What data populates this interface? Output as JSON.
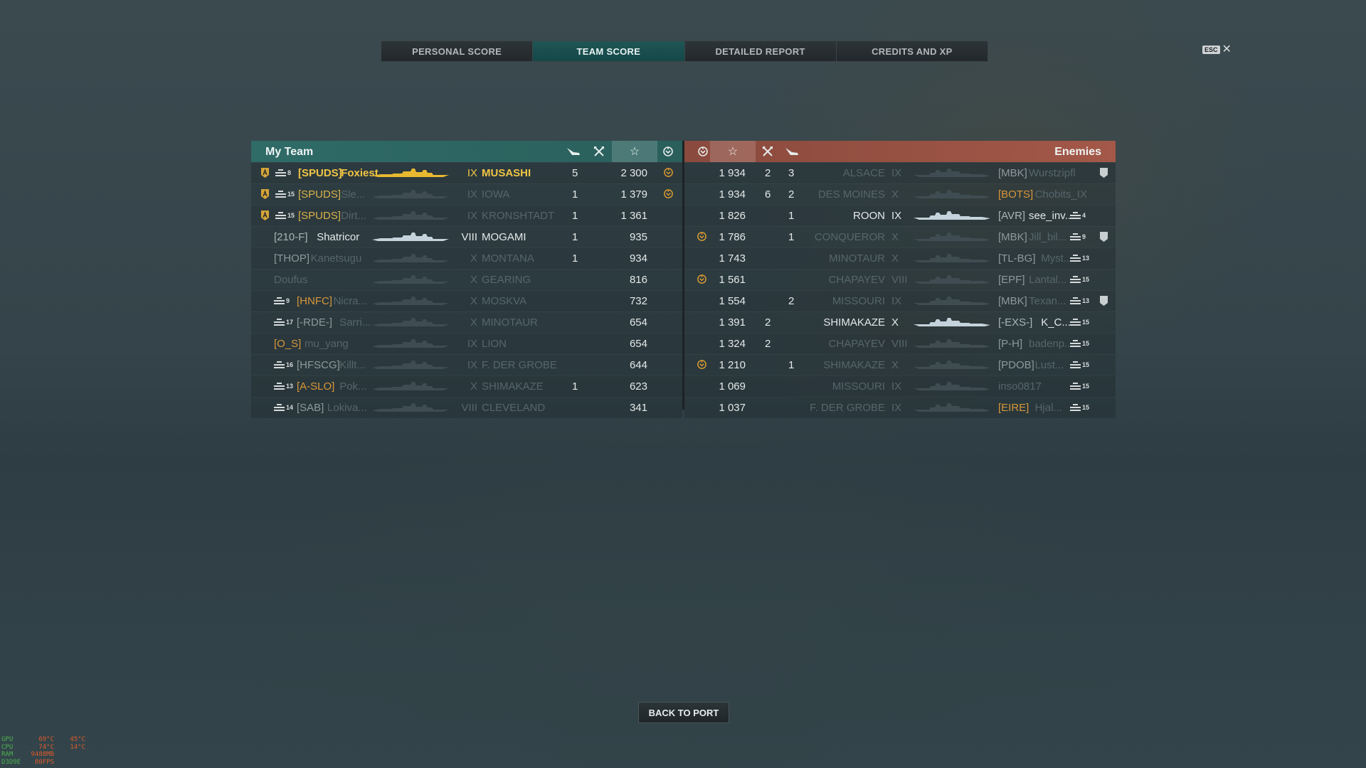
{
  "tabs": [
    "PERSONAL SCORE",
    "TEAM SCORE",
    "DETAILED REPORT",
    "CREDITS AND XP"
  ],
  "active_tab": 1,
  "close": {
    "key": "ESC",
    "symbol": "✕"
  },
  "my_team": {
    "title": "My Team",
    "rows": [
      {
        "division": true,
        "rank": "8",
        "clan": "[SPUDS]",
        "name": "Foxiest",
        "tier": "IX",
        "ship": "MUSASHI",
        "kills": "5",
        "xp": "2 300",
        "ribbon": true,
        "style": "self"
      },
      {
        "division": true,
        "rank": "15",
        "clan": "[SPUDS]",
        "name": "Sle...",
        "tier": "IX",
        "ship": "IOWA",
        "kills": "1",
        "xp": "1 379",
        "ribbon": true,
        "style": "div"
      },
      {
        "division": true,
        "rank": "15",
        "clan": "[SPUDS]",
        "name": "Dirt...",
        "tier": "IX",
        "ship": "KRONSHTADT",
        "kills": "1",
        "xp": "1 361",
        "ribbon": false,
        "style": "div"
      },
      {
        "division": false,
        "rank": "",
        "clan": "[210-F]",
        "name": "Shatricor",
        "tier": "VIII",
        "ship": "MOGAMI",
        "kills": "1",
        "xp": "935",
        "ribbon": false,
        "style": "alive"
      },
      {
        "division": false,
        "rank": "",
        "clan": "[THOP]",
        "name": "Kanetsugu",
        "tier": "X",
        "ship": "MONTANA",
        "kills": "1",
        "xp": "934",
        "ribbon": false,
        "style": "dead"
      },
      {
        "division": false,
        "rank": "",
        "clan": "",
        "name": "Doufus",
        "tier": "X",
        "ship": "GEARING",
        "kills": "",
        "xp": "816",
        "ribbon": false,
        "style": "dead"
      },
      {
        "division": false,
        "rank": "9",
        "clan": "[HNFC]",
        "name": "Nicra...",
        "tier": "X",
        "ship": "MOSKVA",
        "kills": "",
        "xp": "732",
        "ribbon": false,
        "style": "dead-orange"
      },
      {
        "division": false,
        "rank": "17",
        "clan": "[-RDE-]",
        "name": "Sarri...",
        "tier": "X",
        "ship": "MINOTAUR",
        "kills": "",
        "xp": "654",
        "ribbon": false,
        "style": "dead"
      },
      {
        "division": false,
        "rank": "",
        "clan": "[O_S]",
        "name": "mu_yang",
        "tier": "IX",
        "ship": "LION",
        "kills": "",
        "xp": "654",
        "ribbon": false,
        "style": "dead-orange"
      },
      {
        "division": false,
        "rank": "16",
        "clan": "[HFSCG]",
        "name": "Killt...",
        "tier": "IX",
        "ship": "F. DER GROBE",
        "kills": "",
        "xp": "644",
        "ribbon": false,
        "style": "dead"
      },
      {
        "division": false,
        "rank": "13",
        "clan": "[A-SLO]",
        "name": "Pok...",
        "tier": "X",
        "ship": "SHIMAKAZE",
        "kills": "1",
        "xp": "623",
        "ribbon": false,
        "style": "dead-orange"
      },
      {
        "division": false,
        "rank": "14",
        "clan": "[SAB]",
        "name": "Lokiva...",
        "tier": "VIII",
        "ship": "CLEVELAND",
        "kills": "",
        "xp": "341",
        "ribbon": false,
        "style": "dead"
      }
    ]
  },
  "enemies": {
    "title": "Enemies",
    "rows": [
      {
        "ribbon": false,
        "xp": "1 934",
        "kills": "2",
        "planes": "3",
        "ship": "ALSACE",
        "tier": "IX",
        "clan": "[MBK]",
        "name": "Wurstzipfl",
        "rank": "",
        "badge": true,
        "style": "dead"
      },
      {
        "ribbon": false,
        "xp": "1 934",
        "kills": "6",
        "planes": "2",
        "ship": "DES MOINES",
        "tier": "X",
        "clan": "[BOTS]",
        "name": "Chobits_IX",
        "rank": "",
        "badge": false,
        "style": "dead-orange"
      },
      {
        "ribbon": false,
        "xp": "1 826",
        "kills": "",
        "planes": "1",
        "ship": "ROON",
        "tier": "IX",
        "clan": "[AVR]",
        "name": "see_inv...",
        "rank": "4",
        "badge": false,
        "style": "alive"
      },
      {
        "ribbon": true,
        "xp": "1 786",
        "kills": "",
        "planes": "1",
        "ship": "CONQUEROR",
        "tier": "X",
        "clan": "[MBK]",
        "name": "Jill_bil...",
        "rank": "9",
        "badge": true,
        "style": "dead"
      },
      {
        "ribbon": false,
        "xp": "1 743",
        "kills": "",
        "planes": "",
        "ship": "MINOTAUR",
        "tier": "X",
        "clan": "[TL-BG]",
        "name": "Myst...",
        "rank": "13",
        "badge": false,
        "style": "dead"
      },
      {
        "ribbon": true,
        "xp": "1 561",
        "kills": "",
        "planes": "",
        "ship": "CHAPAYEV",
        "tier": "VIII",
        "clan": "[EPF]",
        "name": "Lantal...",
        "rank": "15",
        "badge": false,
        "style": "dead"
      },
      {
        "ribbon": false,
        "xp": "1 554",
        "kills": "",
        "planes": "2",
        "ship": "MISSOURI",
        "tier": "IX",
        "clan": "[MBK]",
        "name": "Texan...",
        "rank": "13",
        "badge": true,
        "style": "dead"
      },
      {
        "ribbon": false,
        "xp": "1 391",
        "kills": "2",
        "planes": "",
        "ship": "SHIMAKAZE",
        "tier": "X",
        "clan": "[-EXS-]",
        "name": "K_C...",
        "rank": "15",
        "badge": false,
        "style": "alive"
      },
      {
        "ribbon": false,
        "xp": "1 324",
        "kills": "2",
        "planes": "",
        "ship": "CHAPAYEV",
        "tier": "VIII",
        "clan": "[P-H]",
        "name": "badenp...",
        "rank": "15",
        "badge": false,
        "style": "dead"
      },
      {
        "ribbon": true,
        "xp": "1 210",
        "kills": "",
        "planes": "1",
        "ship": "SHIMAKAZE",
        "tier": "X",
        "clan": "[PDOB]",
        "name": "Lust...",
        "rank": "15",
        "badge": false,
        "style": "dead"
      },
      {
        "ribbon": false,
        "xp": "1 069",
        "kills": "",
        "planes": "",
        "ship": "MISSOURI",
        "tier": "IX",
        "clan": "",
        "name": "inso0817",
        "rank": "15",
        "badge": false,
        "style": "dead"
      },
      {
        "ribbon": false,
        "xp": "1 037",
        "kills": "",
        "planes": "",
        "ship": "F. DER GROBE",
        "tier": "IX",
        "clan": "[EIRE]",
        "name": "Hjal...",
        "rank": "15",
        "badge": false,
        "style": "dead-orange"
      }
    ]
  },
  "back_button": "BACK TO PORT",
  "osd": [
    {
      "label": "GPU",
      "v1": "69°C",
      "v2": "45°C"
    },
    {
      "label": "CPU",
      "v1": "74°C",
      "v2": "14°C"
    },
    {
      "label": "RAM",
      "v1": "9488MB",
      "v2": ""
    },
    {
      "label": "D3D9E",
      "v1": "80FPS",
      "v2": ""
    }
  ],
  "colors": {
    "my_team_header": "#2f6b67",
    "enemy_header": "#a35848",
    "gold": "#f1c545",
    "orange": "#d8963a",
    "dead": "#55666b"
  }
}
